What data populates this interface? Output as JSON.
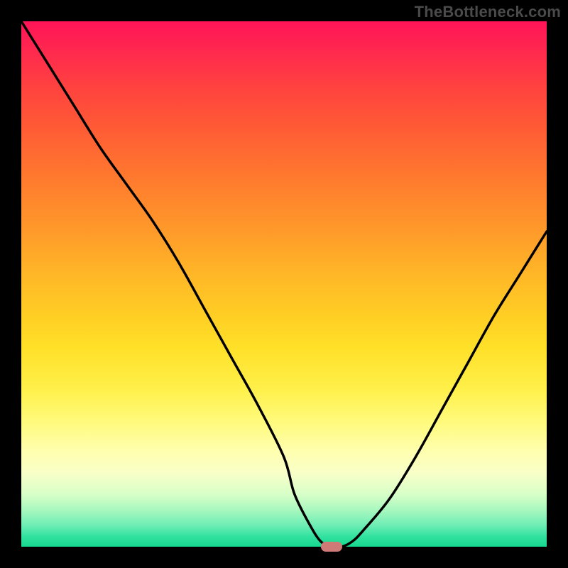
{
  "watermark": "TheBottleneck.com",
  "colors": {
    "background": "#000000",
    "text_muted": "#4a4a4a",
    "curve": "#000000",
    "marker": "#cf7a77"
  },
  "chart_data": {
    "type": "line",
    "title": "",
    "xlabel": "",
    "ylabel": "",
    "xlim": [
      0,
      100
    ],
    "ylim": [
      0,
      100
    ],
    "grid": false,
    "legend": false,
    "x": [
      0,
      5,
      10,
      15,
      20,
      25,
      30,
      35,
      40,
      45,
      50,
      52,
      55,
      57,
      59,
      61,
      63,
      65,
      70,
      75,
      80,
      85,
      90,
      95,
      100
    ],
    "values": [
      100,
      92,
      84,
      76,
      69,
      62,
      54,
      45,
      36,
      27,
      17,
      10,
      4,
      1,
      0,
      0,
      1,
      3,
      9,
      17,
      26,
      35,
      44,
      52,
      60
    ],
    "flat_segment_x": [
      55,
      62
    ],
    "marker": {
      "x": 59,
      "y": 0
    },
    "annotations": []
  }
}
